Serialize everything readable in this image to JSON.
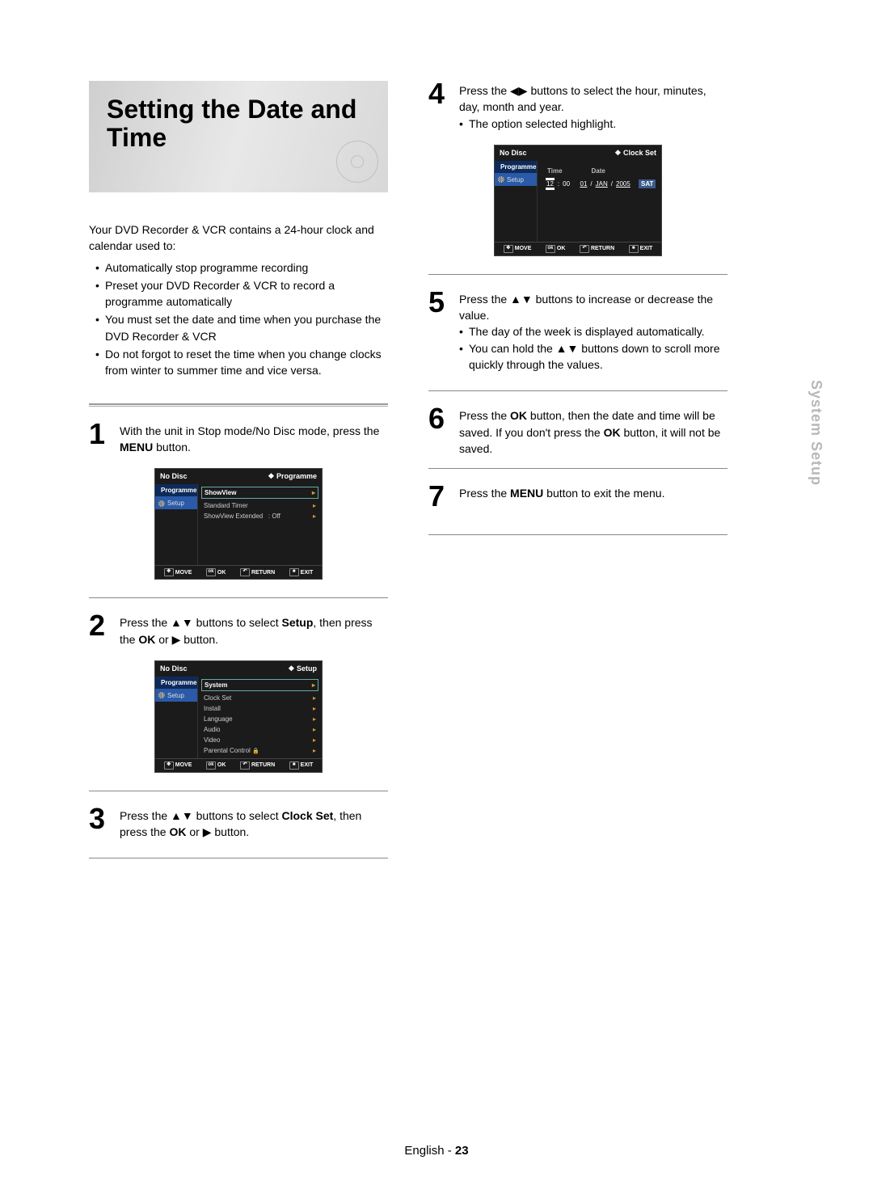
{
  "title": "Setting the Date and Time",
  "sidebar_label": "System Setup",
  "footer": {
    "lang": "English",
    "dash": "-",
    "page": "23"
  },
  "intro": "Your DVD Recorder & VCR contains a 24-hour clock and calendar used to:",
  "intro_bullets": [
    "Automatically stop programme recording",
    "Preset your DVD Recorder & VCR to record a programme automatically",
    "You must set the date and time when you purchase the DVD Recorder & VCR",
    "Do not forgot to reset the time when you change clocks from winter to summer time and vice versa."
  ],
  "steps": {
    "s1": {
      "num": "1",
      "pre": "With the unit in Stop mode/No Disc mode, press the ",
      "b": "MENU",
      "post": " button."
    },
    "s2": {
      "num": "2",
      "pre": "Press the ▲▼ buttons to select ",
      "b": "Setup",
      "mid": ", then press the ",
      "b2": "OK",
      "post": " or ▶ button."
    },
    "s3": {
      "num": "3",
      "pre": "Press the ▲▼ buttons to select ",
      "b": "Clock Set",
      "mid": ", then press the ",
      "b2": "OK",
      "post": " or ▶ button."
    },
    "s4": {
      "num": "4",
      "line1": "Press the ◀▶ buttons to select the hour, minutes, day, month and year.",
      "sub": "The option selected highlight."
    },
    "s5": {
      "num": "5",
      "line1": "Press the ▲▼ buttons to increase or decrease the value.",
      "subs": [
        "The day of the week is displayed automatically.",
        "You can hold the ▲▼ buttons down to scroll more quickly through the values."
      ]
    },
    "s6": {
      "num": "6",
      "parts": [
        "Press the ",
        "OK",
        " button, then the date and time will be saved. If you don't press the ",
        "OK",
        " button, it will not be saved."
      ]
    },
    "s7": {
      "num": "7",
      "pre": "Press the ",
      "b": "MENU",
      "post": " button to exit the menu."
    }
  },
  "osd_common": {
    "no_disc": "No Disc",
    "side_prog": "Programme",
    "side_setup": "Setup",
    "foot_move": "MOVE",
    "foot_ok": "OK",
    "foot_return": "RETURN",
    "foot_exit": "EXIT"
  },
  "osd1": {
    "crumb": "Programme",
    "rows": [
      {
        "label": "ShowView",
        "val": "",
        "sel": true
      },
      {
        "label": "Standard Timer",
        "val": ""
      },
      {
        "label": "ShowView Extended",
        "val": ": Off"
      }
    ]
  },
  "osd2": {
    "crumb": "Setup",
    "rows": [
      {
        "label": "System",
        "sel": true
      },
      {
        "label": "Clock Set"
      },
      {
        "label": "Install"
      },
      {
        "label": "Language"
      },
      {
        "label": "Audio"
      },
      {
        "label": "Video"
      },
      {
        "label": "Parental Control",
        "lock": true
      }
    ]
  },
  "osd3": {
    "crumb": "Clock Set",
    "time_label": "Time",
    "date_label": "Date",
    "hh": "12",
    "mm": "00",
    "dd": "01",
    "mon": "JAN",
    "yy": "2005",
    "dow": "SAT"
  },
  "glyph": {
    "diamond": "❖",
    "rarr": "▸",
    "lock": "🔒"
  }
}
